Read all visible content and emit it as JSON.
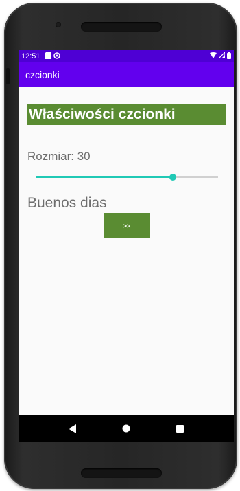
{
  "status_bar": {
    "time": "12:51",
    "icons": [
      "sd-card-icon",
      "sync-icon",
      "wifi-icon",
      "signal-icon",
      "battery-icon"
    ]
  },
  "app_bar": {
    "title": "czcionki"
  },
  "content": {
    "heading": "Właściwości czcionki",
    "size_label": "Rozmiar: 30",
    "slider_fraction": 0.75,
    "sample_text": "Buenos dias",
    "next_button_label": ">>"
  },
  "navigation_bar": {
    "buttons": [
      "back-icon",
      "home-icon",
      "recents-icon"
    ]
  },
  "colors": {
    "status_bar": "#4e00d4",
    "app_bar": "#6200ee",
    "accent_green": "#5a8c32",
    "slider_teal": "#20c9b5",
    "muted_text": "#6e6e6e"
  }
}
